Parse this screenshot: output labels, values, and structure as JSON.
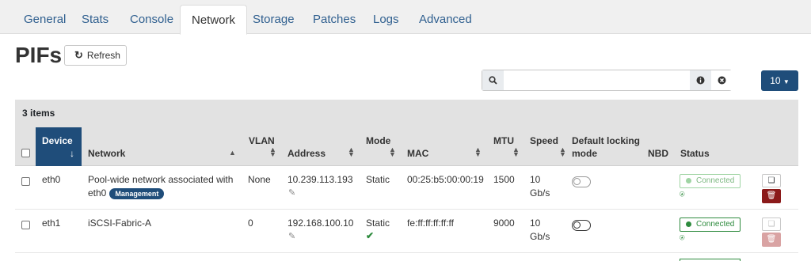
{
  "tabs": [
    "General",
    "Stats",
    "Console",
    "Network",
    "Storage",
    "Patches",
    "Logs",
    "Advanced"
  ],
  "active_tab": "Network",
  "page_title": "PIFs",
  "refresh_label": "Refresh",
  "search": {
    "placeholder": "",
    "value": ""
  },
  "page_size": "10",
  "items_count": "3 items",
  "columns": {
    "device": "Device",
    "network": "Network",
    "vlan": "VLAN",
    "address": "Address",
    "mode": "Mode",
    "mac": "MAC",
    "mtu": "MTU",
    "speed": "Speed",
    "locking_1": "Default locking",
    "locking_2": "mode",
    "nbd": "NBD",
    "status": "Status"
  },
  "rows": [
    {
      "device": "eth0",
      "network_1": "Pool-wide network associated with",
      "network_2": "eth0",
      "badge": "Management",
      "vlan": "None",
      "address": "10.239.113.193",
      "mode": "Static",
      "mac": "00:25:b5:00:00:19",
      "mtu": "1500",
      "speed_1": "10",
      "speed_2": "Gb/s",
      "status": "Connected",
      "status_color": "#9fd4a3"
    },
    {
      "device": "eth1",
      "network_1": "iSCSI-Fabric-A",
      "vlan": "0",
      "address": "192.168.100.10",
      "mode": "Static",
      "mac": "fe:ff:ff:ff:ff:ff",
      "mtu": "9000",
      "speed_1": "10",
      "speed_2": "Gb/s",
      "status": "Connected",
      "status_color": "#2e8b3e"
    }
  ],
  "colors": {
    "primary": "#1f4d7a",
    "tab_link": "#2f5f8f",
    "danger": "#8b1a1a",
    "danger_disabled": "#d9a3a3",
    "success": "#2e8b3e"
  }
}
